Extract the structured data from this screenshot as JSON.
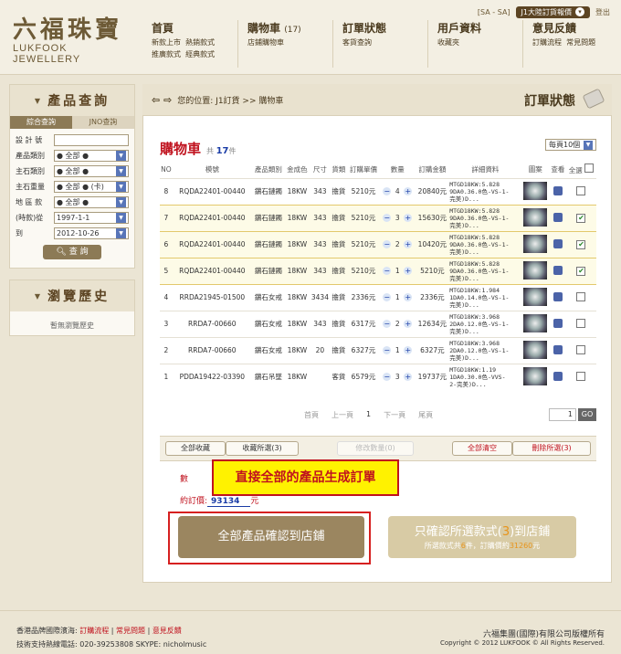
{
  "logo": {
    "cn": "六福珠寶",
    "en": "LUKFOOK JEWELLERY"
  },
  "topbar": {
    "sa": "[SA - SA]",
    "select": "J1大陸訂貨報價",
    "logout": "登出"
  },
  "nav": [
    {
      "title": "首頁",
      "count": "",
      "links": [
        "新款上市",
        "熱銷款式",
        "推廣款式",
        "經典款式"
      ]
    },
    {
      "title": "購物車",
      "count": "(17)",
      "links": [
        "店鋪購物車"
      ]
    },
    {
      "title": "訂單狀態",
      "count": "",
      "links": [
        "客貨查詢"
      ]
    },
    {
      "title": "用戶資料",
      "count": "",
      "links": [
        "收藏夾"
      ]
    },
    {
      "title": "意見反饋",
      "count": "",
      "links": [
        "訂購流程",
        "常見問題"
      ]
    }
  ],
  "search": {
    "title": "產品查詢",
    "tabs": [
      "綜合查詢",
      "JNO查詢"
    ],
    "fields": [
      {
        "label": "設 計 號",
        "value": "",
        "dropdown": false
      },
      {
        "label": "產品類別",
        "value": "● 全部 ●",
        "dropdown": true
      },
      {
        "label": "主石類別",
        "value": "● 全部 ●",
        "dropdown": true
      },
      {
        "label": "主石重量",
        "value": "● 全部 ● (卡)",
        "dropdown": true
      },
      {
        "label": "地 區 款",
        "value": "● 全部 ●",
        "dropdown": true
      },
      {
        "label": "(時款)從",
        "value": "1997-1-1",
        "dropdown": true
      },
      {
        "label": "到",
        "value": "2012-10-26",
        "dropdown": true
      }
    ],
    "button": "查 詢"
  },
  "history": {
    "title": "瀏覽歷史",
    "empty": "暫無瀏覽歷史"
  },
  "breadcrumb": "您的位置: J1訂貨 >> 購物車",
  "page_title": "訂單狀態",
  "cart": {
    "title": "購物車",
    "count_prefix": "共",
    "count": "17",
    "count_suffix": "件",
    "per_page": "每頁10個",
    "headers": [
      "NO",
      "模號",
      "產品類別",
      "金成色",
      "尺寸",
      "貨類",
      "訂購單價",
      "數量",
      "訂購金額",
      "詳細資料",
      "圖案",
      "查看",
      "全選"
    ],
    "rows": [
      {
        "no": "8",
        "model": "RQDA22401-00440",
        "cat": "鑽石鏈鐲",
        "gold": "18KW",
        "size": "343",
        "type": "擔貨",
        "price": "5210元",
        "qty": "4",
        "amount": "20840元",
        "detail": [
          "MTGD18KW:5.828",
          "9DA0.36.0色-VS-1-",
          "完美)D..."
        ],
        "selected": false
      },
      {
        "no": "7",
        "model": "RQDA22401-00440",
        "cat": "鑽石鏈鐲",
        "gold": "18KW",
        "size": "343",
        "type": "擔貨",
        "price": "5210元",
        "qty": "3",
        "amount": "15630元",
        "detail": [
          "MTGD18KW:5.828",
          "9DA0.36.0色-VS-1-",
          "完美)D..."
        ],
        "selected": true
      },
      {
        "no": "6",
        "model": "RQDA22401-00440",
        "cat": "鑽石鏈鐲",
        "gold": "18KW",
        "size": "343",
        "type": "擔貨",
        "price": "5210元",
        "qty": "2",
        "amount": "10420元",
        "detail": [
          "MTGD18KW:5.828",
          "9DA0.36.0色-VS-1-",
          "完美)D..."
        ],
        "selected": true
      },
      {
        "no": "5",
        "model": "RQDA22401-00440",
        "cat": "鑽石鏈鐲",
        "gold": "18KW",
        "size": "343",
        "type": "擔貨",
        "price": "5210元",
        "qty": "1",
        "amount": "5210元",
        "detail": [
          "MTGD18KW:5.828",
          "9DA0.36.0色-VS-1-",
          "完美)D..."
        ],
        "selected": true
      },
      {
        "no": "4",
        "model": "RRDA21945-01500",
        "cat": "鑽石女戒",
        "gold": "18KW",
        "size": "3434",
        "type": "擔貨",
        "price": "2336元",
        "qty": "1",
        "amount": "2336元",
        "detail": [
          "MTGD18KW:1.984",
          "1DA0.14.0色-VS-1-",
          "完美)D..."
        ],
        "selected": false
      },
      {
        "no": "3",
        "model": "RRDA7-00660",
        "cat": "鑽石女戒",
        "gold": "18KW",
        "size": "343",
        "type": "擔貨",
        "price": "6317元",
        "qty": "2",
        "amount": "12634元",
        "detail": [
          "MTGD18KW:3.968",
          "2DA0.12.0色-VS-1-",
          "完美)D..."
        ],
        "selected": false
      },
      {
        "no": "2",
        "model": "RRDA7-00660",
        "cat": "鑽石女戒",
        "gold": "18KW",
        "size": "20",
        "type": "擔貨",
        "price": "6327元",
        "qty": "1",
        "amount": "6327元",
        "detail": [
          "MTGD18KW:3.968",
          "2DA0.12.0色-VS-1-",
          "完美)D..."
        ],
        "selected": false
      },
      {
        "no": "1",
        "model": "PDDA19422-03390",
        "cat": "鑽石吊墜",
        "gold": "18KW",
        "size": "",
        "type": "客貨",
        "price": "6579元",
        "qty": "3",
        "amount": "19737元",
        "detail": [
          "MTGD18KW:1.19",
          "1DA0.30.0色-VVS-",
          "2-完美)D..."
        ],
        "selected": false
      }
    ]
  },
  "pager": {
    "first": "首頁",
    "prev": "上一頁",
    "current": "1",
    "next": "下一頁",
    "last": "尾頁",
    "input": "1",
    "go": "GO"
  },
  "actions": {
    "collect_all": "全部收藏",
    "collect_selected": "收藏所選(3)",
    "modify_qty": "修改數量(0)",
    "clear_all": "全部清空",
    "delete_selected": "刪除所選(3)"
  },
  "totals": {
    "qty_label": "數",
    "price_label": "約訂價:",
    "price_value": "93134",
    "unit": "元"
  },
  "callout": "直接全部的產品生成訂單",
  "confirm_all": "全部產品確認到店鋪",
  "confirm_selected": {
    "pre": "只確認所選款式(",
    "n": "3",
    "post": ")到店鋪",
    "sub_pre": "所選款式共",
    "sub_n": "6",
    "sub_mid": "件，訂購價約",
    "sub_price": "31260",
    "sub_post": "元"
  },
  "footer": {
    "hotline_label": "香港品牌國際濱海:",
    "links": [
      "訂購流程",
      "常見問題",
      "意見反饋"
    ],
    "support": "技術支持熱線電話:  020-39253808     SKYPE:  nicholmusic",
    "company": "六福集團(國際)有限公司版權所有",
    "copyright": "Copyright © 2012 LUKFOOK © All Rights Reserved."
  }
}
